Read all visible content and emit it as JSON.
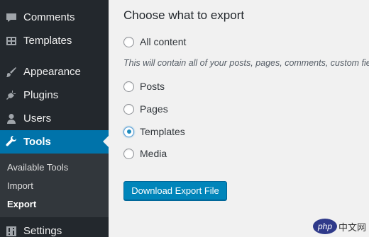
{
  "sidebar": {
    "items": [
      {
        "label": "Comments",
        "icon": "comments-icon"
      },
      {
        "label": "Templates",
        "icon": "templates-icon"
      },
      {
        "label": "Appearance",
        "icon": "appearance-icon"
      },
      {
        "label": "Plugins",
        "icon": "plugins-icon"
      },
      {
        "label": "Users",
        "icon": "users-icon"
      },
      {
        "label": "Tools",
        "icon": "tools-icon",
        "current": true
      },
      {
        "label": "Settings",
        "icon": "settings-icon"
      }
    ],
    "submenu": [
      "Available Tools",
      "Import",
      "Export"
    ],
    "submenu_current": "Export"
  },
  "main": {
    "heading": "Choose what to export",
    "options": [
      {
        "label": "All content",
        "checked": false
      },
      {
        "label": "Posts",
        "checked": false
      },
      {
        "label": "Pages",
        "checked": false
      },
      {
        "label": "Templates",
        "checked": true
      },
      {
        "label": "Media",
        "checked": false
      }
    ],
    "description": "This will contain all of your posts, pages, comments, custom fie",
    "button": "Download Export File"
  },
  "watermark": {
    "logo": "php",
    "text": "中文网"
  },
  "colors": {
    "sidebar_bg": "#23282d",
    "accent": "#0073aa",
    "button": "#0085ba",
    "content_bg": "#f1f1f1"
  }
}
